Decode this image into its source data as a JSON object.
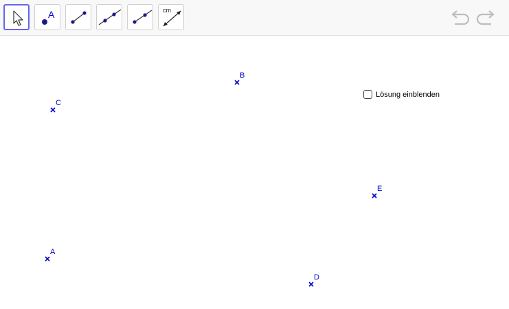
{
  "toolbar": {
    "tools": [
      {
        "name": "move-tool",
        "icon": "cursor-arrow-icon"
      },
      {
        "name": "point-tool",
        "icon": "point-icon",
        "label": "A"
      },
      {
        "name": "segment-tool",
        "icon": "segment-icon"
      },
      {
        "name": "line-tool",
        "icon": "line-icon"
      },
      {
        "name": "ray-tool",
        "icon": "ray-icon"
      },
      {
        "name": "distance-tool",
        "icon": "distance-icon",
        "label": "cm"
      }
    ],
    "undo_icon": "undo-icon",
    "redo_icon": "redo-icon"
  },
  "canvas": {
    "points": [
      {
        "label": "B"
      },
      {
        "label": "C"
      },
      {
        "label": "E"
      },
      {
        "label": "A"
      },
      {
        "label": "D"
      }
    ],
    "checkbox": {
      "label": "Lösung einblenden",
      "checked": false
    }
  },
  "colors": {
    "point": "#0000cc",
    "tool_selected_border": "#6666ee",
    "icon_point": "#1a1a8c"
  }
}
